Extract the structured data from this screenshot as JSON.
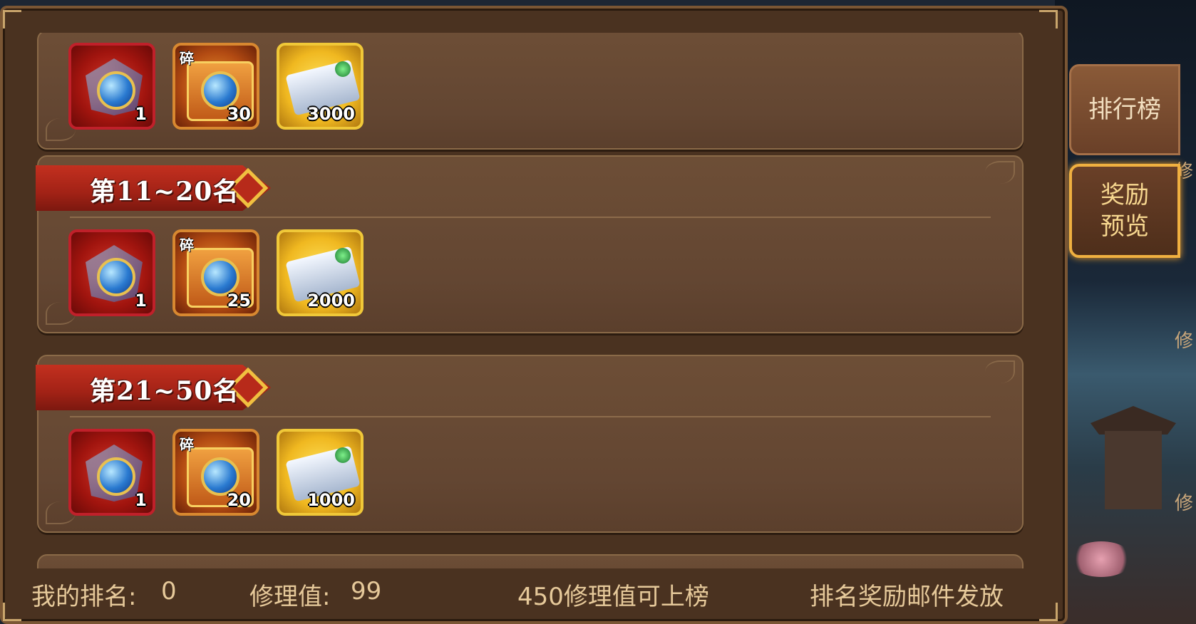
{
  "tiers": [
    {
      "label": "",
      "rewards": [
        {
          "kind": "treasure-box",
          "count": "1"
        },
        {
          "kind": "chest-fragment",
          "mark": "碎",
          "count": "30"
        },
        {
          "kind": "scroll",
          "count": "3000"
        }
      ]
    },
    {
      "label": "第11~20名",
      "rewards": [
        {
          "kind": "treasure-box",
          "count": "1"
        },
        {
          "kind": "chest-fragment",
          "mark": "碎",
          "count": "25"
        },
        {
          "kind": "scroll",
          "count": "2000"
        }
      ]
    },
    {
      "label": "第21~50名",
      "rewards": [
        {
          "kind": "treasure-box",
          "count": "1"
        },
        {
          "kind": "chest-fragment",
          "mark": "碎",
          "count": "20"
        },
        {
          "kind": "scroll",
          "count": "1000"
        }
      ]
    }
  ],
  "footer": {
    "my_rank_label": "我的排名:",
    "my_rank_value": "0",
    "repair_label": "修理值:",
    "repair_value": "99",
    "threshold_note": "450修理值可上榜",
    "mail_note": "排名奖励邮件发放"
  },
  "side_tabs": {
    "leaderboard": "排行榜",
    "reward_preview_line1": "奖励",
    "reward_preview_line2": "预览"
  },
  "side_edge_text": [
    "修",
    "修",
    "修"
  ],
  "colors": {
    "banner_red": "#b72a1a",
    "active_tab_gold": "#f0b040",
    "footer_text": "#e6c99a"
  }
}
